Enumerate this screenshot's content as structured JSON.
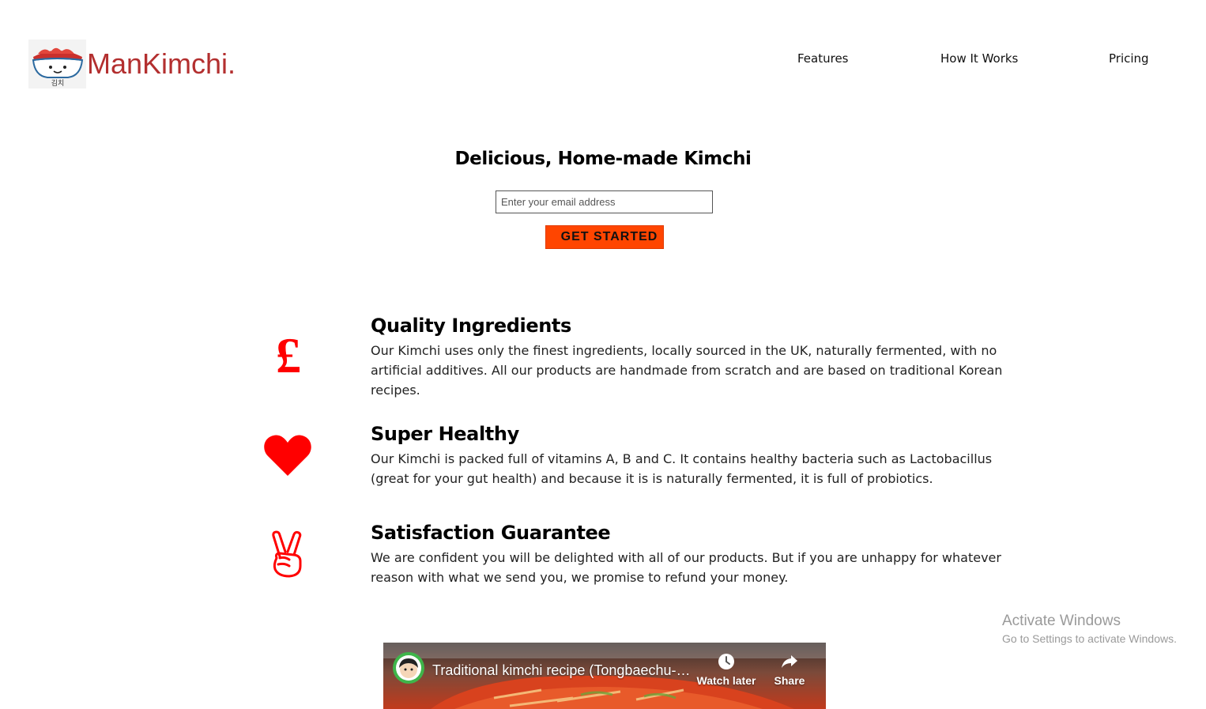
{
  "header": {
    "logo_text": "ManKimchi.",
    "logo_sub": "김치",
    "nav": [
      {
        "label": "Features"
      },
      {
        "label": "How It Works"
      },
      {
        "label": "Pricing"
      }
    ]
  },
  "hero": {
    "title": "Delicious, Home-made Kimchi",
    "email_placeholder": "Enter your email address",
    "cta_label": "GET STARTED"
  },
  "features": [
    {
      "icon": "pound-icon",
      "icon_glyph": "£",
      "title": "Quality Ingredients",
      "description": "Our Kimchi uses only the finest ingredients, locally sourced in the UK, naturally fermented, with no artificial additives. All our products are handmade from scratch and are based on traditional Korean recipes."
    },
    {
      "icon": "heart-icon",
      "title": "Super Healthy",
      "description": "Our Kimchi is packed full of vitamins A, B and C. It contains healthy bacteria such as Lactobacillus (great for your gut health) and because it is is naturally fermented, it is full of probiotics."
    },
    {
      "icon": "peace-hand-icon",
      "title": "Satisfaction Guarantee",
      "description": "We are confident you will be delighted with all of our products. But if you are unhappy for whatever reason with what we send you, we promise to refund your money."
    }
  ],
  "video": {
    "title": "Traditional kimchi recipe (Tongbaechu-kimchi: 통배추김치)",
    "watch_later": "Watch later",
    "share": "Share"
  },
  "watermark": {
    "title": "Activate Windows",
    "subtitle": "Go to Settings to activate Windows."
  },
  "colors": {
    "brand": "#b32f2f",
    "accent": "#ff4500",
    "icon": "#ff0000"
  }
}
